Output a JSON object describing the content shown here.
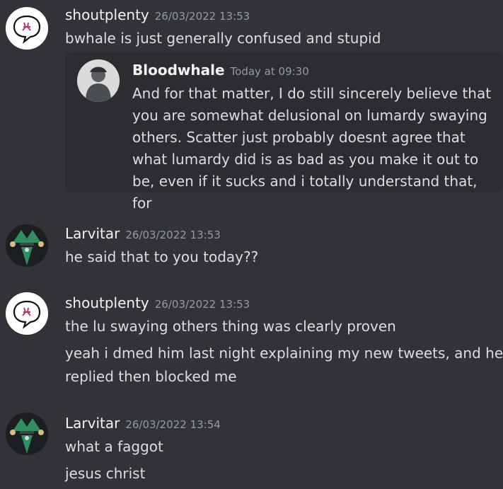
{
  "messages": [
    {
      "author": "shoutplenty",
      "timestamp": "26/03/2022 13:53",
      "lines": [
        "bwhale is just generally confused and stupid"
      ],
      "embed": {
        "author": "Bloodwhale",
        "timestamp": "Today at 09:30",
        "text": "And for that matter, I do still sincerely believe that you are somewhat delusional on lumardy swaying others. Scatter just probably doesnt agree that what lumardy did is as bad as you make it out to be, even if it sucks and i totally understand that, for"
      }
    },
    {
      "author": "Larvitar",
      "timestamp": "26/03/2022 13:53",
      "lines": [
        "he said that to you today??"
      ]
    },
    {
      "author": "shoutplenty",
      "timestamp": "26/03/2022 13:53",
      "lines": [
        "the lu swaying others thing was clearly proven",
        "yeah i dmed him last night explaining my new tweets, and he",
        "replied then blocked me"
      ]
    },
    {
      "author": "Larvitar",
      "timestamp": "26/03/2022 13:54",
      "lines": [
        "what a faggot",
        "jesus christ"
      ]
    }
  ]
}
